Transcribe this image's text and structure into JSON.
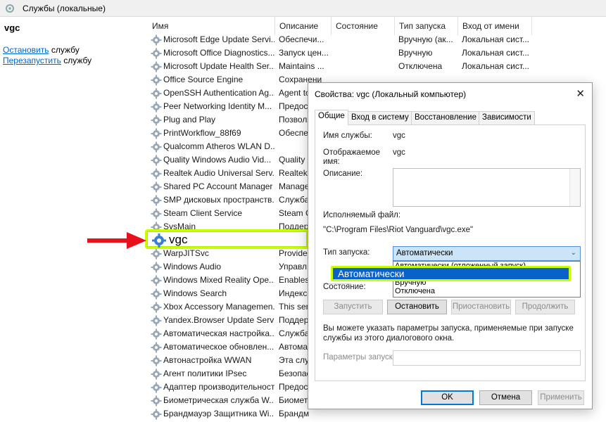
{
  "window": {
    "title": "Службы (локальные)",
    "service_name": "vgc",
    "actions": {
      "stop_link": "Остановить",
      "stop_rest": " службу",
      "restart_link": "Перезапустить",
      "restart_rest": " службу"
    }
  },
  "columns": [
    "Имя",
    "Описание",
    "Состояние",
    "Тип запуска",
    "Вход от имени"
  ],
  "rows": [
    {
      "name": "Microsoft Edge Update Servi...",
      "desc": "Обеспечи...",
      "state": "",
      "startup": "Вручную (ак...",
      "logon": "Локальная сист..."
    },
    {
      "name": "Microsoft Office Diagnostics...",
      "desc": "Запуск цен...",
      "state": "",
      "startup": "Вручную",
      "logon": "Локальная сист..."
    },
    {
      "name": "Microsoft Update Health Ser...",
      "desc": "Maintains ...",
      "state": "",
      "startup": "Отключена",
      "logon": "Локальная сист..."
    },
    {
      "name": "Office Source Engine",
      "desc": "Сохранени",
      "state": "",
      "startup": "",
      "logon": ""
    },
    {
      "name": "OpenSSH Authentication Ag...",
      "desc": "Agent to",
      "state": "",
      "startup": "",
      "logon": ""
    },
    {
      "name": "Peer Networking Identity M...",
      "desc": "Предост",
      "state": "",
      "startup": "",
      "logon": ""
    },
    {
      "name": "Plug and Play",
      "desc": "Позволя",
      "state": "",
      "startup": "",
      "logon": ""
    },
    {
      "name": "PrintWorkflow_88f69",
      "desc": "Обеспеч",
      "state": "",
      "startup": "",
      "logon": ""
    },
    {
      "name": "Qualcomm Atheros WLAN D...",
      "desc": "",
      "state": "",
      "startup": "",
      "logon": ""
    },
    {
      "name": "Quality Windows Audio Vid...",
      "desc": "Quality",
      "state": "",
      "startup": "",
      "logon": ""
    },
    {
      "name": "Realtek Audio Universal Serv...",
      "desc": "Realtek",
      "state": "",
      "startup": "",
      "logon": ""
    },
    {
      "name": "Shared PC Account Manager",
      "desc": "Manage",
      "state": "",
      "startup": "",
      "logon": ""
    },
    {
      "name": "SMP дисковых пространств...",
      "desc": "Служба",
      "state": "",
      "startup": "",
      "logon": ""
    },
    {
      "name": "Steam Client Service",
      "desc": "Steam C",
      "state": "",
      "startup": "",
      "logon": ""
    },
    {
      "name": "SysMain",
      "desc": "Поддерж",
      "state": "",
      "startup": "",
      "logon": ""
    },
    {
      "name": "vgc",
      "desc": "",
      "state": "",
      "startup": "",
      "logon": ""
    },
    {
      "name": "WarpJITSvc",
      "desc": "Provide",
      "state": "",
      "startup": "",
      "logon": ""
    },
    {
      "name": "Windows Audio",
      "desc": "Управл",
      "state": "",
      "startup": "",
      "logon": ""
    },
    {
      "name": "Windows Mixed Reality Ope...",
      "desc": "Enables",
      "state": "",
      "startup": "",
      "logon": ""
    },
    {
      "name": "Windows Search",
      "desc": "Индекс",
      "state": "",
      "startup": "",
      "logon": ""
    },
    {
      "name": "Xbox Accessory Managemen...",
      "desc": "This ser",
      "state": "",
      "startup": "",
      "logon": ""
    },
    {
      "name": "Yandex.Browser Update Servi...",
      "desc": "Поддер",
      "state": "",
      "startup": "",
      "logon": ""
    },
    {
      "name": "Автоматическая настройка...",
      "desc": "Служба",
      "state": "",
      "startup": "",
      "logon": ""
    },
    {
      "name": "Автоматическое обновлен...",
      "desc": "Автома",
      "state": "",
      "startup": "",
      "logon": ""
    },
    {
      "name": "Автонастройка WWAN",
      "desc": "Эта слу",
      "state": "",
      "startup": "",
      "logon": ""
    },
    {
      "name": "Агент политики IPsec",
      "desc": "Безопас",
      "state": "",
      "startup": "",
      "logon": ""
    },
    {
      "name": "Адаптер производительност...",
      "desc": "Предос",
      "state": "",
      "startup": "",
      "logon": ""
    },
    {
      "name": "Биометрическая служба W...",
      "desc": "Биомет",
      "state": "",
      "startup": "",
      "logon": ""
    },
    {
      "name": "Брандмауэр Защитника Wi...",
      "desc": "Брандм",
      "state": "",
      "startup": "",
      "logon": ""
    }
  ],
  "highlight_label": "vgc",
  "dialog": {
    "title": "Свойства: vgc (Локальный компьютер)",
    "close": "✕",
    "tabs": [
      "Общие",
      "Вход в систему",
      "Восстановление",
      "Зависимости"
    ],
    "service_name_label": "Имя службы:",
    "service_name_value": "vgc",
    "display_name_label_1": "Отображаемое",
    "display_name_label_2": "имя:",
    "display_name_value": "vgc",
    "description_label": "Описание:",
    "exe_label": "Исполняемый файл:",
    "exe_value": "\"C:\\Program Files\\Riot Vanguard\\vgc.exe\"",
    "startup_label": "Тип запуска:",
    "startup_value": "Автоматически",
    "startup_options": [
      "Автоматически (отложенный запуск)",
      "Автоматически",
      "Вручную",
      "Отключена"
    ],
    "state_label": "Состояние:",
    "buttons": {
      "start": "Запустить",
      "stop": "Остановить",
      "pause": "Приостановить",
      "resume": "Продолжить"
    },
    "hint": "Вы можете указать параметры запуска, применяемые при запуске службы из этого диалогового окна.",
    "params_label": "Параметры запуска:",
    "ok": "OK",
    "cancel": "Отмена",
    "apply": "Применить"
  },
  "colors": {
    "highlight_border": "#c8ff00",
    "selection": "#0a62c8",
    "arrow": "#e8101b",
    "link": "#0066cc"
  }
}
